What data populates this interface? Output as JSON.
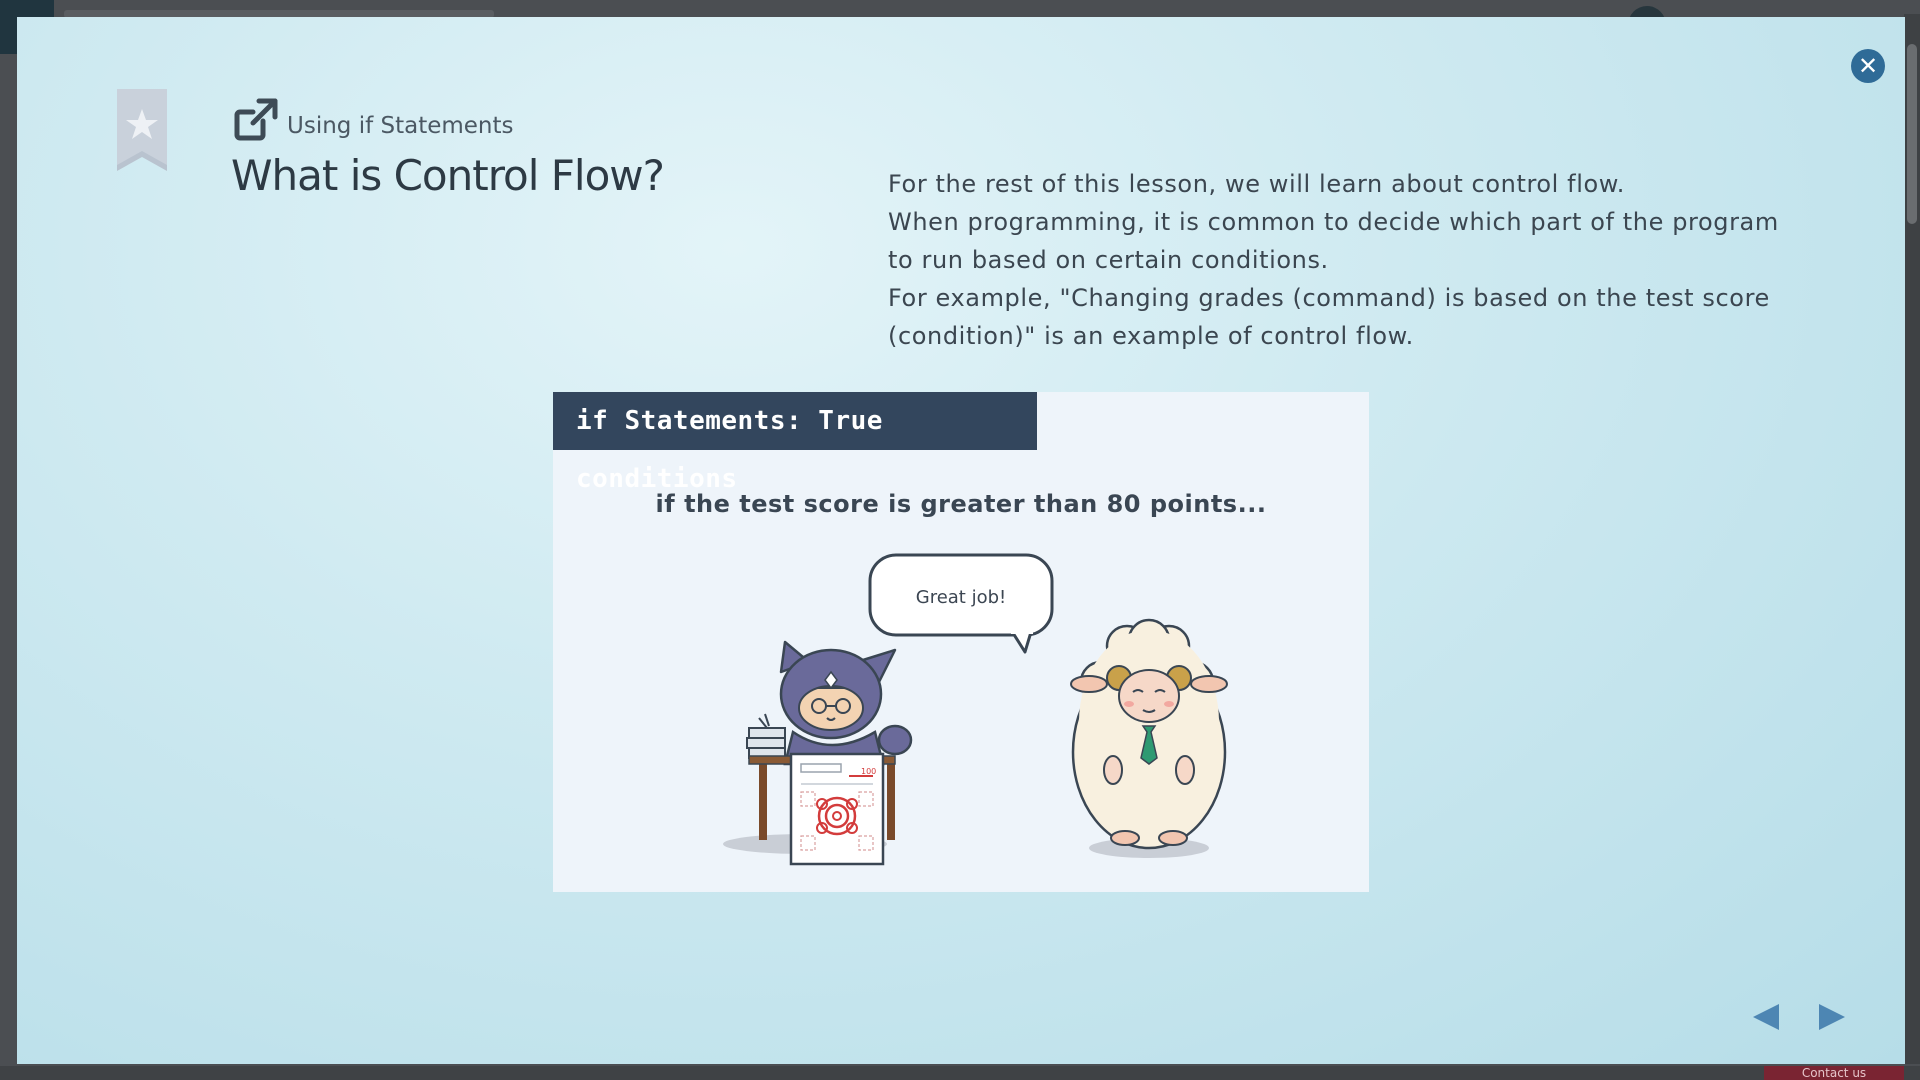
{
  "modal": {
    "lesson_link_label": "Using if Statements",
    "title": "What is Control Flow?",
    "description": [
      "For the rest of this lesson, we will learn about control flow.",
      "When programming, it is common to decide which part of the program to run based on certain conditions.",
      "For example, \"Changing grades (command) is based on the test score (condition)\" is an example of control flow."
    ],
    "close_icon": "close-icon",
    "bookmark_icon": "bookmark-star-icon",
    "lesson_link_icon": "external-link-icon"
  },
  "slide": {
    "header": "if Statements: True conditions",
    "subtitle": "if the test score is greater than 80 points...",
    "speech_bubble": "Great job!",
    "test_paper_score": "100"
  },
  "navigation": {
    "prev_icon": "previous-arrow-icon",
    "next_icon": "next-arrow-icon"
  },
  "background": {
    "contact_label": "Contact us"
  },
  "colors": {
    "accent": "#2f6b97",
    "slide_header": "#33465d",
    "nav_arrow": "#4d86b3"
  }
}
